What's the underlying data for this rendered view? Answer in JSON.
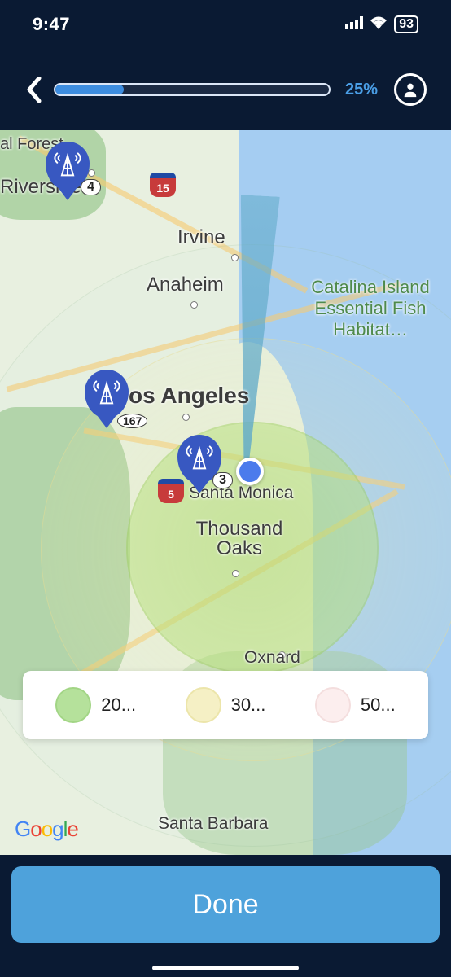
{
  "status_bar": {
    "time": "9:47",
    "battery": "93"
  },
  "header": {
    "progress_percent": 25,
    "progress_text": "25%"
  },
  "map": {
    "labels": {
      "forest": "al Forest",
      "riverside": "Riverside",
      "irvine": "Irvine",
      "anaheim": "Anaheim",
      "catalina": "Catalina Island Essential Fish Habitat…",
      "los_angeles": "os Angeles",
      "santa_monica": "Santa Monica",
      "thousand_oaks": "Thousand Oaks",
      "oxnard": "Oxnard",
      "santa_barbara": "Santa Barbara"
    },
    "highways": {
      "i15": "15",
      "i5": "5",
      "hwy167": "167"
    },
    "pins": [
      {
        "id": "pin-riverside",
        "badge": "4"
      },
      {
        "id": "pin-los-angeles",
        "badge": null
      },
      {
        "id": "pin-santa-monica",
        "badge": "3"
      }
    ],
    "legend": [
      {
        "label": "20...",
        "color": "green"
      },
      {
        "label": "30...",
        "color": "yellow"
      },
      {
        "label": "50...",
        "color": "pink"
      }
    ],
    "attribution": "Google"
  },
  "footer": {
    "done": "Done"
  }
}
